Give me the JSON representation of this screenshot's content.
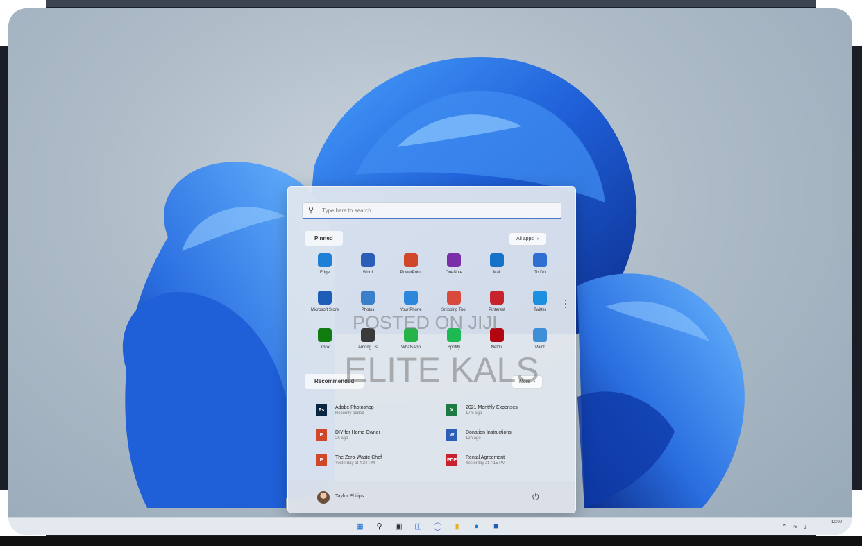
{
  "search": {
    "placeholder": "Type here to search"
  },
  "pinned": {
    "label": "Pinned",
    "all_apps_label": "All apps",
    "apps": [
      {
        "label": "Edge",
        "icon": "edge-icon",
        "color": "#1e7fd6"
      },
      {
        "label": "Word",
        "icon": "word-icon",
        "color": "#2b5fb7"
      },
      {
        "label": "PowerPoint",
        "icon": "powerpoint-icon",
        "color": "#d0472a"
      },
      {
        "label": "OneNote",
        "icon": "onenote-icon",
        "color": "#7a2fa8"
      },
      {
        "label": "Mail",
        "icon": "mail-icon",
        "color": "#1672c9"
      },
      {
        "label": "To Do",
        "icon": "todo-icon",
        "color": "#2f6fd4"
      },
      {
        "label": "Microsoft Store",
        "icon": "store-icon",
        "color": "#1d5db5"
      },
      {
        "label": "Photos",
        "icon": "photos-icon",
        "color": "#3a7fc9"
      },
      {
        "label": "Your Phone",
        "icon": "phone-icon",
        "color": "#2c86dc"
      },
      {
        "label": "Snipping Tool",
        "icon": "snipping-icon",
        "color": "#d94a3c"
      },
      {
        "label": "Pinterest",
        "icon": "pinterest-icon",
        "color": "#c8232c"
      },
      {
        "label": "Twitter",
        "icon": "twitter-icon",
        "color": "#1d8fe0"
      },
      {
        "label": "Xbox",
        "icon": "xbox-icon",
        "color": "#107c10"
      },
      {
        "label": "Among Us",
        "icon": "amongus-icon",
        "color": "#3a3a3a"
      },
      {
        "label": "WhatsApp",
        "icon": "whatsapp-icon",
        "color": "#25b34a"
      },
      {
        "label": "Spotify",
        "icon": "spotify-icon",
        "color": "#1db954"
      },
      {
        "label": "Netflix",
        "icon": "netflix-icon",
        "color": "#b20710"
      },
      {
        "label": "Paint",
        "icon": "paint-icon",
        "color": "#3f8fd6"
      }
    ]
  },
  "recommended": {
    "label": "Recommended",
    "more_label": "More",
    "items": [
      {
        "title": "Adobe Photoshop",
        "subtitle": "Recently added",
        "icon": "photoshop-icon",
        "color": "#0a2540",
        "glyph": "Ps"
      },
      {
        "title": "2021 Monthly Expenses",
        "subtitle": "17m ago",
        "icon": "excel-icon",
        "color": "#1e7a45",
        "glyph": "X"
      },
      {
        "title": "DIY for Home Owner",
        "subtitle": "2h ago",
        "icon": "powerpoint-file-icon",
        "color": "#d0472a",
        "glyph": "P"
      },
      {
        "title": "Donation Instructions",
        "subtitle": "12h ago",
        "icon": "word-file-icon",
        "color": "#2b5fb7",
        "glyph": "W"
      },
      {
        "title": "The Zero-Waste Chef",
        "subtitle": "Yesterday at 4:24 PM",
        "icon": "powerpoint-file-icon",
        "color": "#d0472a",
        "glyph": "P"
      },
      {
        "title": "Rental Agreement",
        "subtitle": "Yesterday at 7:15 PM",
        "icon": "pdf-file-icon",
        "color": "#c8232c",
        "glyph": "PDF"
      }
    ]
  },
  "user": {
    "name": "Taylor Philips"
  },
  "watermark": {
    "line1": "POSTED ON JIJI",
    "line2": "ELITE KALS"
  },
  "taskbar": {
    "icons": [
      "start-icon",
      "search-icon",
      "task-view-icon",
      "widgets-icon",
      "chat-icon",
      "file-explorer-icon",
      "edge-icon",
      "store-icon"
    ],
    "clock": "10:00"
  },
  "colors": {
    "accent": "#4a77c9",
    "wallpaper_bloom": "#1f5fd8"
  }
}
